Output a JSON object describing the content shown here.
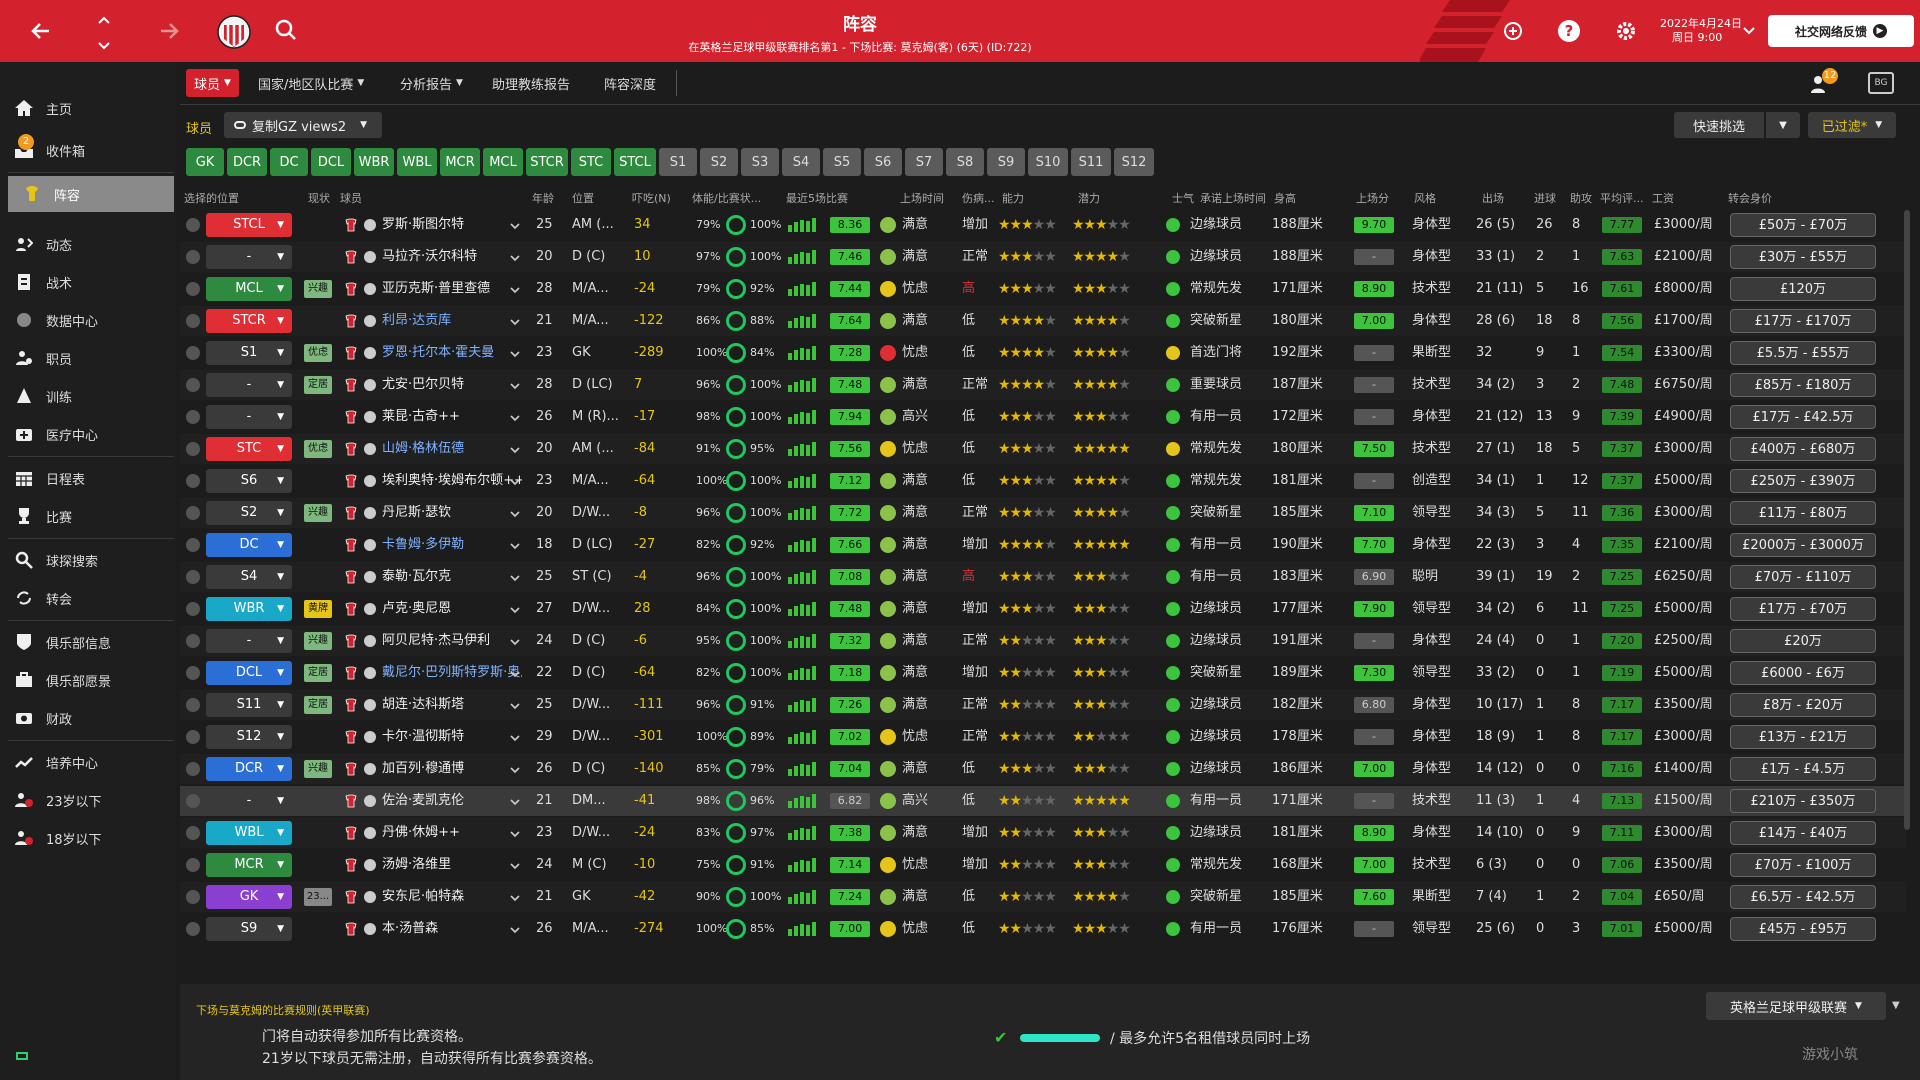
{
  "header": {
    "title": "阵容",
    "subtitle": "在英格兰足球甲级联赛排名第1 - 下场比赛: 莫克姆(客) (6天) (ID:722)",
    "date_line1": "2022年4月24日",
    "date_line2": "周日 9:00",
    "social_label": "社交网络反馈"
  },
  "sidebar": {
    "inbox_badge": "2",
    "items": [
      {
        "label": "主页",
        "icon": "home-icon"
      },
      {
        "label": "收件箱",
        "icon": "inbox-icon"
      },
      {
        "label": "阵容",
        "icon": "squad-icon"
      },
      {
        "label": "动态",
        "icon": "dynamics-icon"
      },
      {
        "label": "战术",
        "icon": "tactics-icon"
      },
      {
        "label": "数据中心",
        "icon": "data-hub-icon"
      },
      {
        "label": "职员",
        "icon": "staff-icon"
      },
      {
        "label": "训练",
        "icon": "training-icon"
      },
      {
        "label": "医疗中心",
        "icon": "medical-icon"
      },
      {
        "label": "日程表",
        "icon": "schedule-icon"
      },
      {
        "label": "比赛",
        "icon": "trophy-icon"
      },
      {
        "label": "球探搜索",
        "icon": "scout-search-icon"
      },
      {
        "label": "转会",
        "icon": "transfer-icon"
      },
      {
        "label": "俱乐部信息",
        "icon": "club-info-icon"
      },
      {
        "label": "俱乐部愿景",
        "icon": "club-vision-icon"
      },
      {
        "label": "财政",
        "icon": "finance-icon"
      },
      {
        "label": "培养中心",
        "icon": "development-icon"
      },
      {
        "label": "23岁以下",
        "icon": "u23-icon"
      },
      {
        "label": "18岁以下",
        "icon": "u18-icon"
      }
    ]
  },
  "nav": {
    "tabs": [
      "球员",
      "国家/地区队比赛",
      "分析报告",
      "助理教练报告",
      "阵容深度"
    ],
    "notif_count": "12",
    "section_label": "球员",
    "view_label": "复制GZ views2",
    "quick_pick": "快速挑选",
    "filter_label": "已过滤*"
  },
  "positions": {
    "on": [
      "GK",
      "DCR",
      "DC",
      "DCL",
      "WBR",
      "WBL",
      "MCR",
      "MCL",
      "STCR",
      "STC",
      "STCL"
    ],
    "off": [
      "S1",
      "S2",
      "S3",
      "S4",
      "S5",
      "S6",
      "S7",
      "S8",
      "S9",
      "S10",
      "S11",
      "S12"
    ]
  },
  "columns": [
    "选择的位置",
    "现状",
    "球员",
    "年龄",
    "位置",
    "吓吃(N)",
    "体能/比赛状...",
    "最近5场比赛",
    "上场时间",
    "伤病...",
    "能力",
    "潜力",
    "士气",
    "承诺上场时间",
    "身高",
    "上场分",
    "风格",
    "出场",
    "进球",
    "助攻",
    "平均评...",
    "工资",
    "转会身价"
  ],
  "players": [
    {
      "sel": "STCL",
      "sc": "red",
      "status": "",
      "name": "罗斯·斯图尔特",
      "age": "25",
      "pos": "AM (...",
      "val": "34",
      "fit": "79%",
      "match": "100%",
      "last5": "8.36",
      "l5c": "g",
      "play": "满意",
      "pm": "g",
      "inj": "增加",
      "ab": "★★★½",
      "pot": "★★★½",
      "mor": "g",
      "promise": "边缘球员",
      "height": "188厘米",
      "apps_r": "9.70",
      "ar": "g",
      "style": "身体型",
      "apps": "26 (5)",
      "goals": "26",
      "assists": "8",
      "avg": "7.77",
      "wage": "£3000/周",
      "value": "£50万 - £70万"
    },
    {
      "sel": "-",
      "sc": "gray",
      "status": "",
      "name": "马拉齐·沃尔科特",
      "age": "20",
      "pos": "D (C)",
      "val": "10",
      "fit": "97%",
      "match": "100%",
      "last5": "7.46",
      "l5c": "g",
      "play": "满意",
      "pm": "g",
      "inj": "正常",
      "ab": "★★★",
      "pot": "★★★★",
      "mor": "g",
      "promise": "边缘球员",
      "height": "188厘米",
      "apps_r": "-",
      "ar": "gr",
      "style": "身体型",
      "apps": "33 (1)",
      "goals": "2",
      "assists": "1",
      "avg": "7.63",
      "wage": "£2100/周",
      "value": "£30万 - £55万"
    },
    {
      "sel": "MCL",
      "sc": "green",
      "status": "兴趣",
      "name": "亚历克斯·普里查德",
      "age": "28",
      "pos": "M/A...",
      "val": "-24",
      "fit": "79%",
      "match": "92%",
      "last5": "7.44",
      "l5c": "g",
      "play": "忧虑",
      "pm": "y",
      "inj": "高",
      "ab": "★★★½",
      "pot": "★★★½",
      "mor": "g",
      "promise": "常规先发",
      "height": "171厘米",
      "apps_r": "8.90",
      "ar": "g",
      "style": "技术型",
      "apps": "21 (11)",
      "goals": "5",
      "assists": "16",
      "avg": "7.61",
      "wage": "£8000/周",
      "value": "£120万"
    },
    {
      "sel": "STCR",
      "sc": "red",
      "status": "",
      "name": "利昂·达贡库",
      "age": "21",
      "pos": "M/A...",
      "val": "-122",
      "fit": "86%",
      "match": "88%",
      "last5": "7.64",
      "l5c": "g",
      "play": "满意",
      "pm": "g",
      "inj": "低",
      "ab": "★★★★",
      "pot": "★★★★",
      "mor": "g",
      "promise": "突破新星",
      "height": "180厘米",
      "apps_r": "7.00",
      "ar": "g",
      "style": "身体型",
      "apps": "28 (6)",
      "goals": "18",
      "assists": "8",
      "avg": "7.56",
      "wage": "£1700/周",
      "value": "£17万 - £170万"
    },
    {
      "sel": "S1",
      "sc": "gray",
      "status": "优虑",
      "name": "罗恩·托尔本·霍夫曼",
      "age": "23",
      "pos": "GK",
      "val": "-289",
      "fit": "100%",
      "match": "84%",
      "last5": "7.28",
      "l5c": "g",
      "play": "忧虑",
      "pm": "r",
      "inj": "低",
      "ab": "★★★★",
      "pot": "★★★★",
      "mor": "y",
      "promise": "首选门将",
      "height": "192厘米",
      "apps_r": "-",
      "ar": "gr",
      "style": "果断型",
      "apps": "32",
      "goals": "9",
      "assists": "1",
      "avg": "7.54",
      "wage": "£3300/周",
      "value": "£5.5万 - £55万"
    },
    {
      "sel": "-",
      "sc": "gray",
      "status": "定居",
      "name": "尤安·巴尔贝特",
      "age": "28",
      "pos": "D (LC)",
      "val": "7",
      "fit": "96%",
      "match": "100%",
      "last5": "7.48",
      "l5c": "g",
      "play": "满意",
      "pm": "g",
      "inj": "正常",
      "ab": "★★★★",
      "pot": "★★★★",
      "mor": "g",
      "promise": "重要球员",
      "height": "187厘米",
      "apps_r": "-",
      "ar": "gr",
      "style": "技术型",
      "apps": "34 (2)",
      "goals": "3",
      "assists": "2",
      "avg": "7.48",
      "wage": "£6750/周",
      "value": "£85万 - £180万"
    },
    {
      "sel": "-",
      "sc": "gray",
      "status": "",
      "name": "莱昆·古奇++",
      "age": "26",
      "pos": "M (R)...",
      "val": "-17",
      "fit": "98%",
      "match": "100%",
      "last5": "7.94",
      "l5c": "g",
      "play": "高兴",
      "pm": "g",
      "inj": "低",
      "ab": "★★★½",
      "pot": "★★★½",
      "mor": "g",
      "promise": "有用一员",
      "height": "172厘米",
      "apps_r": "-",
      "ar": "gr",
      "style": "身体型",
      "apps": "21 (12)",
      "goals": "13",
      "assists": "9",
      "avg": "7.39",
      "wage": "£4900/周",
      "value": "£17万 - £42.5万"
    },
    {
      "sel": "STC",
      "sc": "red",
      "status": "优虑",
      "name": "山姆·格林伍德",
      "age": "20",
      "pos": "AM (...",
      "val": "-84",
      "fit": "91%",
      "match": "95%",
      "last5": "7.56",
      "l5c": "g",
      "play": "忧虑",
      "pm": "y",
      "inj": "低",
      "ab": "★★★½",
      "pot": "★★★★★",
      "mor": "y",
      "promise": "常规先发",
      "height": "180厘米",
      "apps_r": "7.50",
      "ar": "g",
      "style": "技术型",
      "apps": "27 (1)",
      "goals": "18",
      "assists": "5",
      "avg": "7.37",
      "wage": "£3000/周",
      "value": "£400万 - £680万"
    },
    {
      "sel": "S6",
      "sc": "gray",
      "status": "",
      "name": "埃利奥特·埃姆布尔顿++",
      "age": "23",
      "pos": "M/A...",
      "val": "-64",
      "fit": "100%",
      "match": "100%",
      "last5": "7.12",
      "l5c": "g",
      "play": "满意",
      "pm": "g",
      "inj": "低",
      "ab": "★★★",
      "pot": "★★★★",
      "mor": "g",
      "promise": "常规先发",
      "height": "181厘米",
      "apps_r": "-",
      "ar": "gr",
      "style": "创造型",
      "apps": "34 (1)",
      "goals": "1",
      "assists": "12",
      "avg": "7.37",
      "wage": "£5000/周",
      "value": "£250万 - £390万"
    },
    {
      "sel": "S2",
      "sc": "gray",
      "status": "兴趣",
      "name": "丹尼斯·瑟钦",
      "age": "20",
      "pos": "D/W...",
      "val": "-8",
      "fit": "96%",
      "match": "100%",
      "last5": "7.72",
      "l5c": "g",
      "play": "满意",
      "pm": "g",
      "inj": "正常",
      "ab": "★★★",
      "pot": "★★★★",
      "mor": "g",
      "promise": "突破新星",
      "height": "185厘米",
      "apps_r": "7.10",
      "ar": "g",
      "style": "领导型",
      "apps": "34 (3)",
      "goals": "5",
      "assists": "11",
      "avg": "7.36",
      "wage": "£3000/周",
      "value": "£11万 - £80万"
    },
    {
      "sel": "DC",
      "sc": "blue",
      "status": "",
      "name": "卡鲁姆·多伊勒",
      "age": "18",
      "pos": "D (LC)",
      "val": "-27",
      "fit": "82%",
      "match": "92%",
      "last5": "7.66",
      "l5c": "g",
      "play": "满意",
      "pm": "g",
      "inj": "增加",
      "ab": "★★★★",
      "pot": "★★★★★",
      "mor": "g",
      "promise": "有用一员",
      "height": "190厘米",
      "apps_r": "7.70",
      "ar": "g",
      "style": "身体型",
      "apps": "22 (3)",
      "goals": "3",
      "assists": "4",
      "avg": "7.35",
      "wage": "£2100/周",
      "value": "£2000万 - £3000万"
    },
    {
      "sel": "S4",
      "sc": "gray",
      "status": "",
      "name": "泰勒·瓦尔克",
      "age": "25",
      "pos": "ST (C)",
      "val": "-4",
      "fit": "96%",
      "match": "100%",
      "last5": "7.08",
      "l5c": "g",
      "play": "满意",
      "pm": "g",
      "inj": "高",
      "ab": "★★★½",
      "pot": "★★★½",
      "mor": "g",
      "promise": "有用一员",
      "height": "183厘米",
      "apps_r": "6.90",
      "ar": "gr",
      "style": "聪明",
      "apps": "39 (1)",
      "goals": "19",
      "assists": "2",
      "avg": "7.25",
      "wage": "£6250/周",
      "value": "£70万 - £110万"
    },
    {
      "sel": "WBR",
      "sc": "cyan",
      "status": "黄牌",
      "name": "卢克·奥尼恩",
      "age": "27",
      "pos": "D/W...",
      "val": "28",
      "fit": "84%",
      "match": "100%",
      "last5": "7.48",
      "l5c": "g",
      "play": "满意",
      "pm": "g",
      "inj": "增加",
      "ab": "★★★",
      "pot": "★★★",
      "mor": "g",
      "promise": "边缘球员",
      "height": "177厘米",
      "apps_r": "7.90",
      "ar": "g",
      "style": "领导型",
      "apps": "34 (2)",
      "goals": "6",
      "assists": "11",
      "avg": "7.25",
      "wage": "£5000/周",
      "value": "£17万 - £70万"
    },
    {
      "sel": "-",
      "sc": "gray",
      "status": "兴趣",
      "name": "阿贝尼特·杰马伊利",
      "age": "24",
      "pos": "D (C)",
      "val": "-6",
      "fit": "95%",
      "match": "100%",
      "last5": "7.32",
      "l5c": "g",
      "play": "满意",
      "pm": "g",
      "inj": "正常",
      "ab": "★★½",
      "pot": "★★★",
      "mor": "g",
      "promise": "边缘球员",
      "height": "191厘米",
      "apps_r": "-",
      "ar": "gr",
      "style": "身体型",
      "apps": "24 (4)",
      "goals": "0",
      "assists": "1",
      "avg": "7.20",
      "wage": "£2500/周",
      "value": "£20万"
    },
    {
      "sel": "DCL",
      "sc": "blue",
      "status": "定居",
      "name": "戴尼尔·巴列斯特罗斯·奥尼",
      "age": "22",
      "pos": "D (C)",
      "val": "-64",
      "fit": "82%",
      "match": "100%",
      "last5": "7.18",
      "l5c": "g",
      "play": "满意",
      "pm": "g",
      "inj": "增加",
      "ab": "★★½",
      "pot": "★★★½",
      "mor": "g",
      "promise": "突破新星",
      "height": "189厘米",
      "apps_r": "7.30",
      "ar": "g",
      "style": "领导型",
      "apps": "33 (2)",
      "goals": "0",
      "assists": "1",
      "avg": "7.19",
      "wage": "£5000/周",
      "value": "£6000 - £6万"
    },
    {
      "sel": "S11",
      "sc": "gray",
      "status": "定居",
      "name": "胡连·达科斯塔",
      "age": "25",
      "pos": "D/W...",
      "val": "-111",
      "fit": "96%",
      "match": "91%",
      "last5": "7.26",
      "l5c": "g",
      "play": "满意",
      "pm": "g",
      "inj": "正常",
      "ab": "★★½",
      "pot": "★★★½",
      "mor": "g",
      "promise": "边缘球员",
      "height": "182厘米",
      "apps_r": "6.80",
      "ar": "gr",
      "style": "身体型",
      "apps": "10 (17)",
      "goals": "1",
      "assists": "8",
      "avg": "7.17",
      "wage": "£3500/周",
      "value": "£8万 - £20万"
    },
    {
      "sel": "S12",
      "sc": "gray",
      "status": "",
      "name": "卡尔·温彻斯特",
      "age": "29",
      "pos": "D/W...",
      "val": "-301",
      "fit": "100%",
      "match": "89%",
      "last5": "7.02",
      "l5c": "g",
      "play": "忧虑",
      "pm": "y",
      "inj": "正常",
      "ab": "★★½",
      "pot": "★★½",
      "mor": "g",
      "promise": "边缘球员",
      "height": "178厘米",
      "apps_r": "-",
      "ar": "gr",
      "style": "身体型",
      "apps": "18 (9)",
      "goals": "1",
      "assists": "8",
      "avg": "7.17",
      "wage": "£3000/周",
      "value": "£13万 - £21万"
    },
    {
      "sel": "DCR",
      "sc": "blue",
      "status": "兴趣",
      "name": "加百列·穆通博",
      "age": "26",
      "pos": "D (C)",
      "val": "-140",
      "fit": "85%",
      "match": "79%",
      "last5": "7.04",
      "l5c": "g",
      "play": "满意",
      "pm": "g",
      "inj": "低",
      "ab": "★★★",
      "pot": "★★★",
      "mor": "g",
      "promise": "边缘球员",
      "height": "186厘米",
      "apps_r": "7.00",
      "ar": "g",
      "style": "身体型",
      "apps": "14 (12)",
      "goals": "0",
      "assists": "0",
      "avg": "7.16",
      "wage": "£1400/周",
      "value": "£1万 - £4.5万"
    },
    {
      "sel": "-",
      "sc": "gray",
      "status": "",
      "name": "佐治·麦凯克伦",
      "age": "21",
      "pos": "DM...",
      "val": "-41",
      "fit": "98%",
      "match": "96%",
      "last5": "6.82",
      "l5c": "gr",
      "play": "高兴",
      "pm": "g",
      "inj": "低",
      "ab": "★★½",
      "pot": "★★★★★",
      "mor": "g",
      "promise": "有用一员",
      "height": "171厘米",
      "apps_r": "-",
      "ar": "gr",
      "style": "技术型",
      "apps": "11 (3)",
      "goals": "1",
      "assists": "4",
      "avg": "7.13",
      "wage": "£1500/周",
      "value": "£210万 - £350万",
      "hl": true
    },
    {
      "sel": "WBL",
      "sc": "cyan",
      "status": "",
      "name": "丹佛·休姆++",
      "age": "23",
      "pos": "D/W...",
      "val": "-24",
      "fit": "83%",
      "match": "97%",
      "last5": "7.38",
      "l5c": "g",
      "play": "满意",
      "pm": "g",
      "inj": "增加",
      "ab": "★★½",
      "pot": "★★★",
      "mor": "g",
      "promise": "边缘球员",
      "height": "181厘米",
      "apps_r": "8.90",
      "ar": "g",
      "style": "身体型",
      "apps": "14 (10)",
      "goals": "0",
      "assists": "9",
      "avg": "7.11",
      "wage": "£3000/周",
      "value": "£14万 - £40万"
    },
    {
      "sel": "MCR",
      "sc": "green",
      "status": "",
      "name": "汤姆·洛维里",
      "age": "24",
      "pos": "M (C)",
      "val": "-10",
      "fit": "75%",
      "match": "91%",
      "last5": "7.14",
      "l5c": "g",
      "play": "忧虑",
      "pm": "y",
      "inj": "增加",
      "ab": "★★½",
      "pot": "★★★",
      "mor": "g",
      "promise": "常规先发",
      "height": "168厘米",
      "apps_r": "7.00",
      "ar": "g",
      "style": "技术型",
      "apps": "6 (3)",
      "goals": "0",
      "assists": "0",
      "avg": "7.06",
      "wage": "£3500/周",
      "value": "£70万 - £100万"
    },
    {
      "sel": "GK",
      "sc": "violet",
      "status": "23...",
      "name": "安东尼·帕特森",
      "age": "21",
      "pos": "GK",
      "val": "-42",
      "fit": "90%",
      "match": "100%",
      "last5": "7.24",
      "l5c": "g",
      "play": "满意",
      "pm": "g",
      "inj": "低",
      "ab": "★★",
      "pot": "★★★★",
      "mor": "g",
      "promise": "突破新星",
      "height": "185厘米",
      "apps_r": "7.60",
      "ar": "g",
      "style": "果断型",
      "apps": "7 (4)",
      "goals": "1",
      "assists": "2",
      "avg": "7.04",
      "wage": "£650/周",
      "value": "£6.5万 - £42.5万"
    },
    {
      "sel": "S9",
      "sc": "gray",
      "status": "",
      "name": "本·汤普森",
      "age": "26",
      "pos": "M/A...",
      "val": "-274",
      "fit": "100%",
      "match": "85%",
      "last5": "7.00",
      "l5c": "g",
      "play": "忧虑",
      "pm": "y",
      "inj": "低",
      "ab": "★★½",
      "pot": "★★★",
      "mor": "g",
      "promise": "有用一员",
      "height": "176厘米",
      "apps_r": "-",
      "ar": "gr",
      "style": "领导型",
      "apps": "25 (6)",
      "goals": "0",
      "assists": "3",
      "avg": "7.01",
      "wage": "£5000/周",
      "value": "£45万 - £95万"
    }
  ],
  "bottom": {
    "rules_title": "下场与莫克姆的比赛规则(英甲联赛)",
    "rule1": "门将自动获得参加所有比赛资格。",
    "rule2": "21岁以下球员无需注册，自动获得所有比赛参赛资格。",
    "loan_rule": "最多允许5名租借球员同时上场",
    "league_label": "英格兰足球甲级联赛",
    "watermark": "游戏小筑"
  },
  "colors": {
    "brand_red": "#d3222d",
    "pos_green": "#2d8a3e",
    "rating_green": "#3cc43c",
    "star_gold": "#e6b800"
  }
}
